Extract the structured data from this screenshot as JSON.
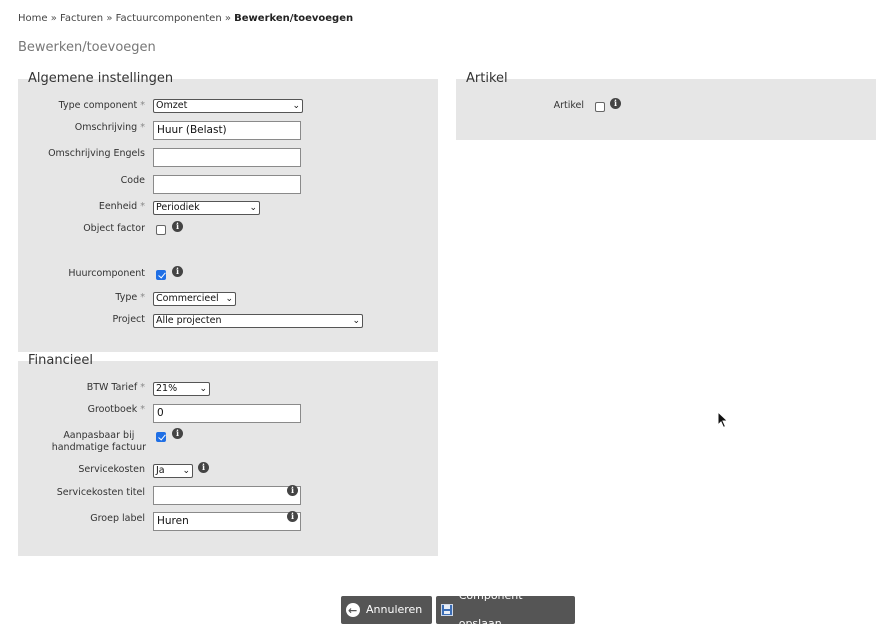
{
  "breadcrumb": {
    "items": [
      "Home",
      "Facturen",
      "Factuurcomponenten"
    ],
    "separator": "»",
    "current": "Bewerken/toevoegen"
  },
  "page_title": "Bewerken/toevoegen",
  "algemene": {
    "legend": "Algemene instellingen",
    "type_component": {
      "label": "Type component",
      "value": "Omzet"
    },
    "omschrijving": {
      "label": "Omschrijving",
      "value": "Huur (Belast)"
    },
    "omschrijving_engels": {
      "label": "Omschrijving Engels",
      "value": ""
    },
    "code": {
      "label": "Code",
      "value": ""
    },
    "eenheid": {
      "label": "Eenheid",
      "value": "Periodiek"
    },
    "object_factor": {
      "label": "Object factor",
      "checked": false
    },
    "huurcomponent": {
      "label": "Huurcomponent",
      "checked": true
    },
    "type": {
      "label": "Type",
      "value": "Commercieel"
    },
    "project": {
      "label": "Project",
      "value": "Alle projecten"
    }
  },
  "financieel": {
    "legend": "Financieel",
    "btw_tarief": {
      "label": "BTW Tarief",
      "value": "21%"
    },
    "grootboek": {
      "label": "Grootboek",
      "value": "0"
    },
    "aanpasbaar": {
      "label_line1": "Aanpasbaar bij",
      "label_line2": "handmatige factuur",
      "checked": true
    },
    "servicekosten": {
      "label": "Servicekosten",
      "value": "Ja"
    },
    "servicekosten_titel": {
      "label": "Servicekosten titel",
      "value": ""
    },
    "groep_label": {
      "label": "Groep label",
      "value": "Huren"
    }
  },
  "artikel": {
    "legend": "Artikel",
    "artikel": {
      "label": "Artikel",
      "checked": false
    }
  },
  "required_marker": "*",
  "info_glyph": "i",
  "chevron_glyph": "⌄",
  "buttons": {
    "cancel": "Annuleren",
    "save": "Component opslaan"
  },
  "colors": {
    "panel_bg": "#e6e6e6",
    "button_bg": "#555555",
    "checkbox_on": "#1f6fe5"
  }
}
